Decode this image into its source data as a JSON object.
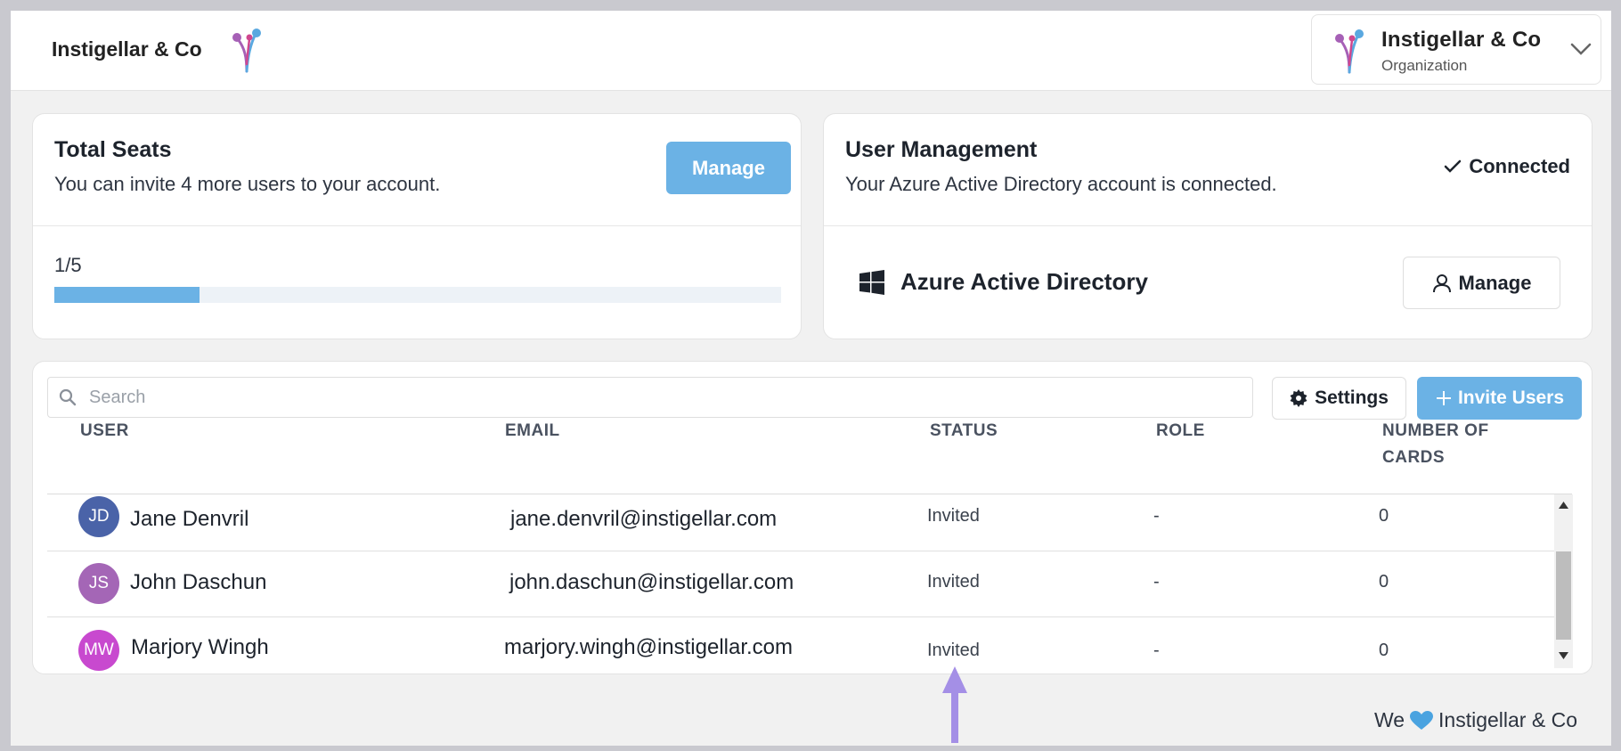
{
  "brand": {
    "name": "Instigellar & Co"
  },
  "org_switcher": {
    "name": "Instigellar & Co",
    "sublabel": "Organization"
  },
  "seats_card": {
    "title": "Total Seats",
    "subtitle": "You can invite 4 more users to your account.",
    "manage_label": "Manage",
    "count_text": "1/5",
    "used": 1,
    "total": 5
  },
  "user_mgmt_card": {
    "title": "User Management",
    "subtitle": "Your Azure Active Directory account is connected.",
    "status_label": "Connected",
    "provider_label": "Azure Active Directory",
    "manage_label": "Manage"
  },
  "users_table": {
    "search_placeholder": "Search",
    "settings_label": "Settings",
    "invite_label": "Invite Users",
    "headers": {
      "user": "USER",
      "email": "EMAIL",
      "status": "STATUS",
      "role": "ROLE",
      "cards": "NUMBER OF CARDS"
    },
    "rows": [
      {
        "initials": "JD",
        "name": "Jane Denvril",
        "email": "jane.denvril@instigellar.com",
        "status": "Invited",
        "role": "-",
        "cards": "0",
        "avatar_color": "#4a63a8"
      },
      {
        "initials": "JS",
        "name": "John Daschun",
        "email": "john.daschun@instigellar.com",
        "status": "Invited",
        "role": "-",
        "cards": "0",
        "avatar_color": "#a466b6"
      },
      {
        "initials": "MW",
        "name": "Marjory Wingh",
        "email": "marjory.wingh@instigellar.com",
        "status": "Invited",
        "role": "-",
        "cards": "0",
        "avatar_color": "#c849cf"
      }
    ]
  },
  "footer": {
    "prefix": "We",
    "suffix": "Instigellar & Co"
  },
  "colors": {
    "accent": "#6bb2e5",
    "annotation_arrow": "#a48fe6",
    "heart": "#4aa3e0"
  }
}
